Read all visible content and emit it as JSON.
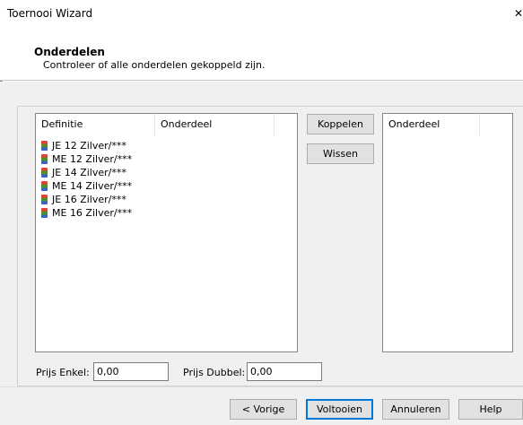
{
  "window": {
    "title": "Toernooi Wizard",
    "close_glyph": "✕"
  },
  "header": {
    "title": "Onderdelen",
    "subtitle": "Controleer of alle onderdelen gekoppeld zijn."
  },
  "left_list": {
    "columns": [
      "Definitie",
      "Onderdeel"
    ],
    "items": [
      {
        "label": "JE 12 Zilver/***",
        "icon": "database-icon"
      },
      {
        "label": "ME 12 Zilver/***",
        "icon": "database-icon"
      },
      {
        "label": "JE 14 Zilver/***",
        "icon": "database-icon"
      },
      {
        "label": "ME 14 Zilver/***",
        "icon": "database-icon"
      },
      {
        "label": "JE 16 Zilver/***",
        "icon": "database-icon"
      },
      {
        "label": "ME 16 Zilver/***",
        "icon": "database-icon"
      }
    ]
  },
  "right_list": {
    "columns": [
      "Onderdeel"
    ]
  },
  "actions": {
    "link_label": "Koppelen",
    "clear_label": "Wissen"
  },
  "prices": {
    "single_label": "Prijs Enkel:",
    "single_value": "0,00",
    "double_label": "Prijs Dubbel:",
    "double_value": "0,00"
  },
  "footer": {
    "back_label": "< Vorige",
    "finish_label": "Voltooien",
    "cancel_label": "Annuleren",
    "help_label": "Help"
  },
  "colors": {
    "accent": "#0078d7",
    "panel": "#f0f0f0"
  }
}
